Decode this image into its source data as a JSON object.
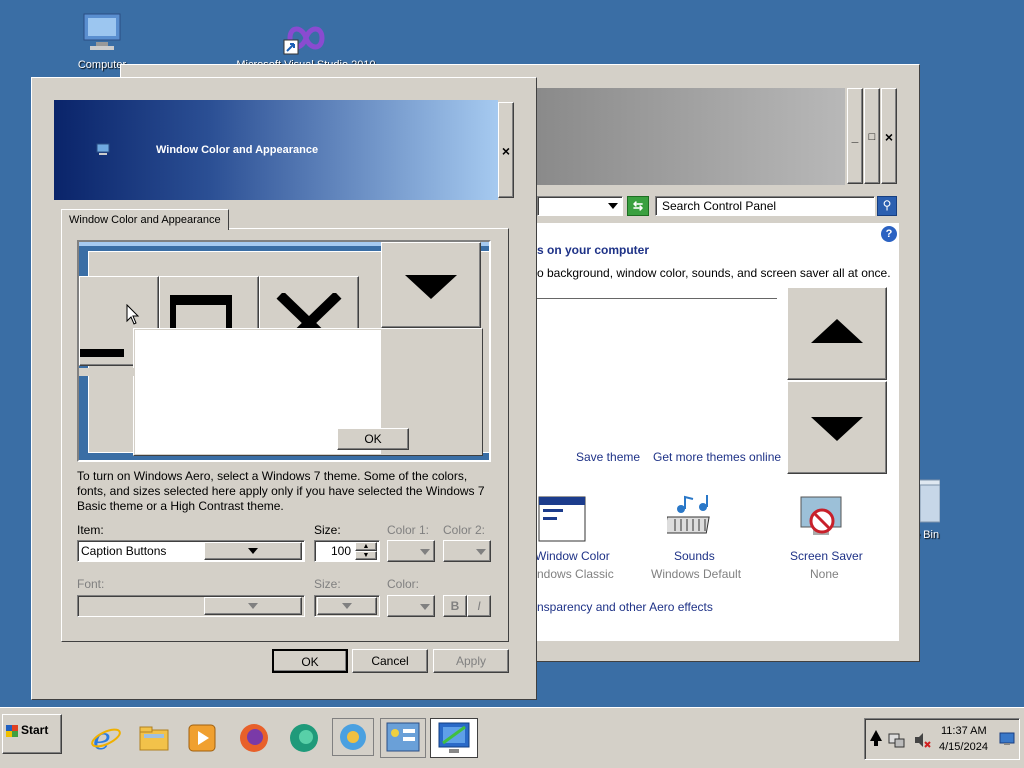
{
  "desktop": {
    "computer_label": "Computer",
    "vs_label": "Microsoft Visual Studio 2010",
    "recycle_label": "Recycle Bin"
  },
  "control_panel": {
    "search_placeholder": "Search Control Panel",
    "heading": "s on your computer",
    "subheading": "o background, window color, sounds, and screen saver all at once.",
    "save_theme": "Save theme",
    "get_more_themes": "Get more themes online",
    "items": [
      {
        "title": "Window Color",
        "sub": "ndows Classic"
      },
      {
        "title": "Sounds",
        "sub": "Windows Default"
      },
      {
        "title": "Screen Saver",
        "sub": "None"
      }
    ],
    "transparency_link": "nsparency and other Aero effects",
    "minimize": "_",
    "maximize": "□",
    "close": "×"
  },
  "dialog": {
    "title": "Window Color and Appearance",
    "close": "×",
    "tab": "Window Color and Appearance",
    "preview_ok": "OK",
    "description": "To turn on Windows Aero, select a Windows 7 theme.  Some of the colors, fonts, and sizes selected here apply only if you have selected the Windows 7 Basic theme or a High Contrast theme.",
    "item_label": "Item:",
    "item_value": "Caption Buttons",
    "size_label": "Size:",
    "size_value": "100",
    "color1_label": "Color 1:",
    "color2_label": "Color 2:",
    "font_label": "Font:",
    "font_size_label": "Size:",
    "font_color_label": "Color:",
    "bold": "B",
    "italic": "I",
    "ok": "OK",
    "cancel": "Cancel",
    "apply": "Apply"
  },
  "taskbar": {
    "start": "Start",
    "time": "11:37 AM",
    "date": "4/15/2024"
  }
}
